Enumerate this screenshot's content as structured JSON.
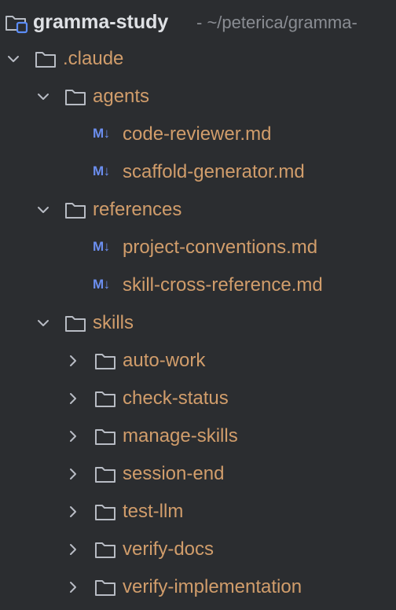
{
  "project": {
    "name": "gramma-study",
    "path": "- ~/peterica/gramma-"
  },
  "colors": {
    "background": "#2b2d30",
    "folder_label": "#d19d6b",
    "md_badge": "#6c8ff0",
    "project_title": "#dfe1e5",
    "path_text": "#8a8d93"
  },
  "tree": {
    "claude": {
      "label": ".claude",
      "expanded": true,
      "agents": {
        "label": "agents",
        "expanded": true,
        "files": [
          {
            "badge": "M↓",
            "label": "code-reviewer.md"
          },
          {
            "badge": "M↓",
            "label": "scaffold-generator.md"
          }
        ]
      },
      "references": {
        "label": "references",
        "expanded": true,
        "files": [
          {
            "badge": "M↓",
            "label": "project-conventions.md"
          },
          {
            "badge": "M↓",
            "label": "skill-cross-reference.md"
          }
        ]
      },
      "skills": {
        "label": "skills",
        "expanded": true,
        "folders": [
          {
            "label": "auto-work",
            "expanded": false
          },
          {
            "label": "check-status",
            "expanded": false
          },
          {
            "label": "manage-skills",
            "expanded": false
          },
          {
            "label": "session-end",
            "expanded": false
          },
          {
            "label": "test-llm",
            "expanded": false
          },
          {
            "label": "verify-docs",
            "expanded": false
          },
          {
            "label": "verify-implementation",
            "expanded": false
          }
        ]
      }
    }
  }
}
